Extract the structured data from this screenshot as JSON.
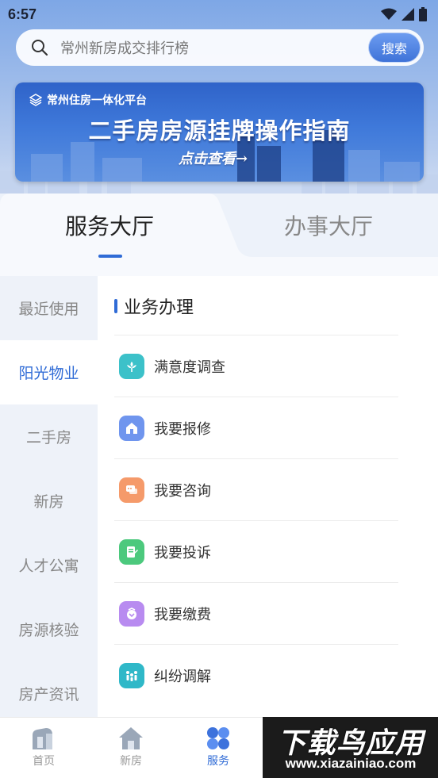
{
  "status_bar": {
    "time": "6:57"
  },
  "search": {
    "placeholder": "常州新房成交排行榜",
    "button_label": "搜索"
  },
  "banner": {
    "brand": "常州住房一体化平台",
    "title": "二手房房源挂牌操作指南",
    "cta": "点击查看→"
  },
  "tabs": [
    {
      "label": "服务大厅",
      "active": true
    },
    {
      "label": "办事大厅",
      "active": false
    }
  ],
  "sidebar": {
    "items": [
      {
        "label": "最近使用",
        "active": false
      },
      {
        "label": "阳光物业",
        "active": true
      },
      {
        "label": "二手房",
        "active": false
      },
      {
        "label": "新房",
        "active": false
      },
      {
        "label": "人才公寓",
        "active": false
      },
      {
        "label": "房源核验",
        "active": false
      },
      {
        "label": "房产资讯",
        "active": false
      }
    ]
  },
  "content": {
    "section_title": "业务办理",
    "services": [
      {
        "label": "满意度调查",
        "icon": "flower-icon",
        "color": "#3cc1c9"
      },
      {
        "label": "我要报修",
        "icon": "house-repair-icon",
        "color": "#6f95ee"
      },
      {
        "label": "我要咨询",
        "icon": "chat-icon",
        "color": "#f59a6a"
      },
      {
        "label": "我要投诉",
        "icon": "document-edit-icon",
        "color": "#4cc97d"
      },
      {
        "label": "我要缴费",
        "icon": "wallet-icon",
        "color": "#b88bf0"
      },
      {
        "label": "纠纷调解",
        "icon": "people-icon",
        "color": "#2fb8c8"
      }
    ]
  },
  "bottom_nav": {
    "items": [
      {
        "label": "首页",
        "icon": "home-building-icon",
        "active": false
      },
      {
        "label": "新房",
        "icon": "house-icon",
        "active": false
      },
      {
        "label": "服务",
        "icon": "grid-icon",
        "active": true
      }
    ]
  },
  "watermark": {
    "title": "下载鸟应用",
    "url": "www.xiazainiao.com"
  },
  "colors": {
    "accent": "#2f6bd6",
    "sidebar_bg": "#eef2f9"
  }
}
